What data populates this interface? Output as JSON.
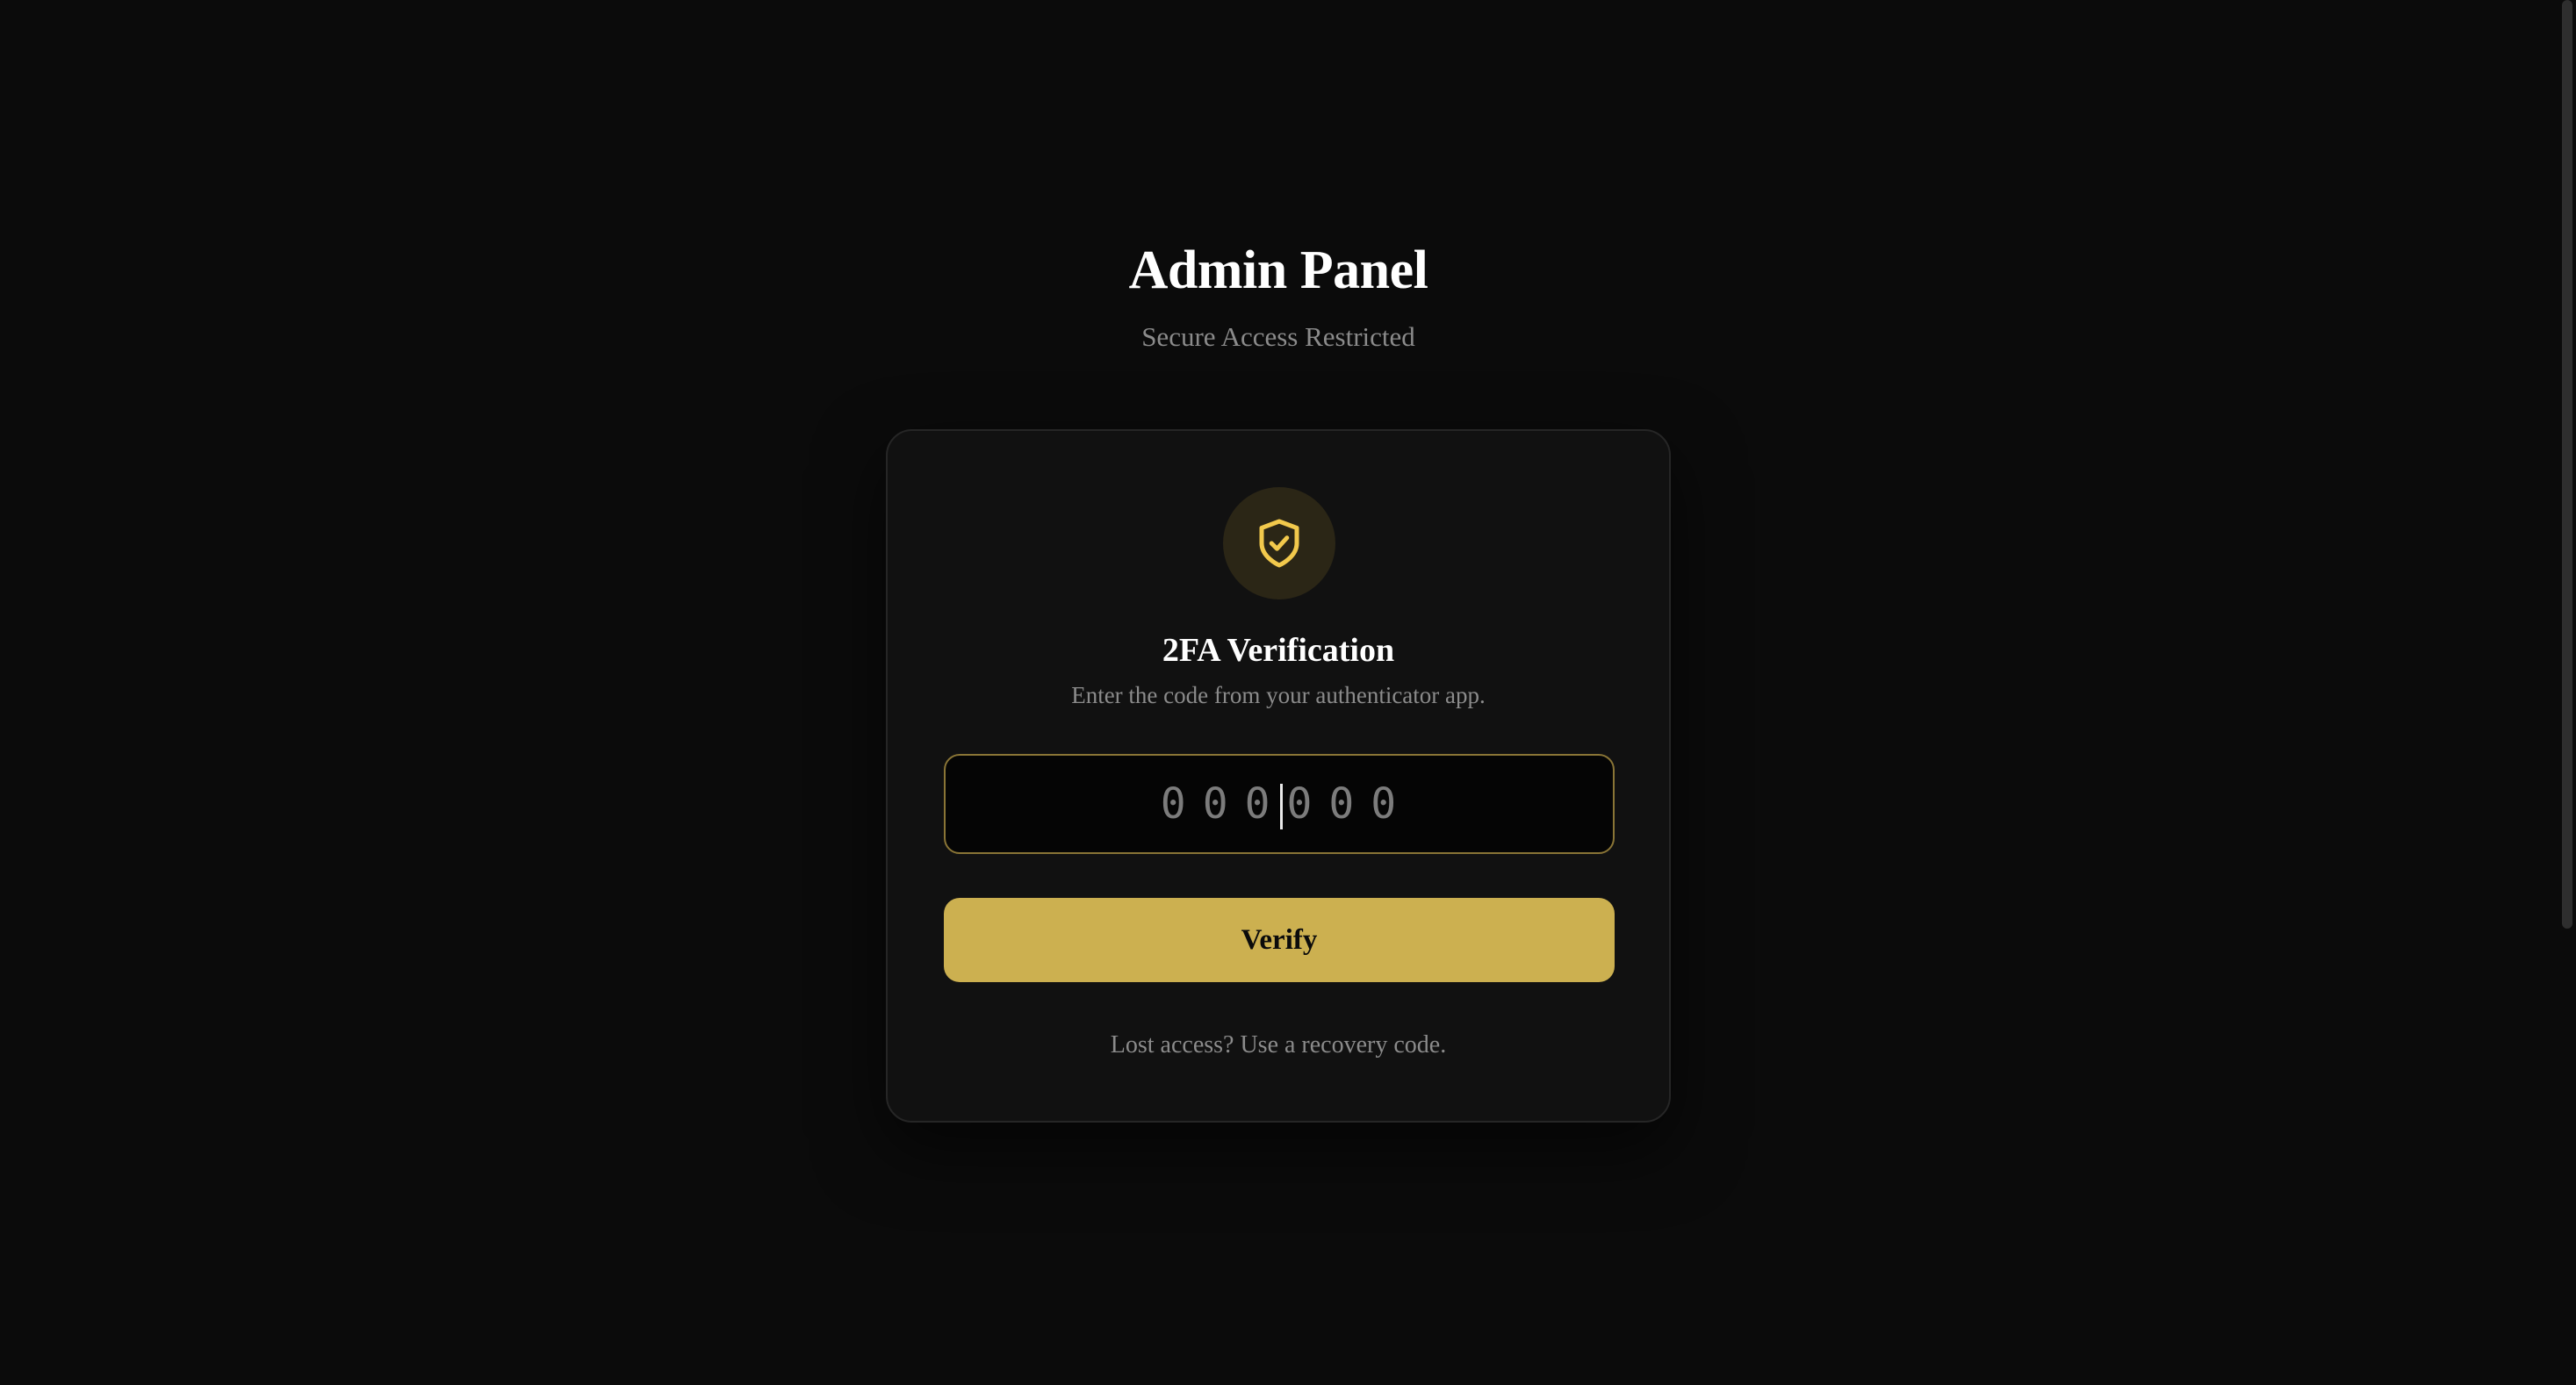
{
  "header": {
    "title": "Admin Panel",
    "subtitle": "Secure Access Restricted"
  },
  "card": {
    "icon": "shield-check-icon",
    "title": "2FA Verification",
    "description": "Enter the code from your authenticator app.",
    "code_input": {
      "value": "",
      "placeholder": "000000"
    },
    "verify_label": "Verify",
    "recovery_text": "Lost access? Use a recovery code."
  },
  "colors": {
    "background": "#0b0b0b",
    "card": "#111111",
    "accent": "#ccb050",
    "icon": "#f2c94c"
  }
}
